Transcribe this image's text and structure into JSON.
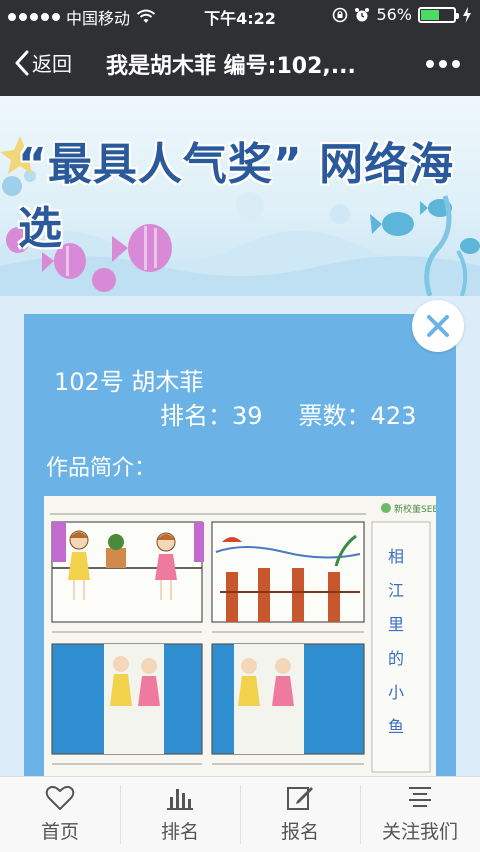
{
  "status": {
    "carrier": "中国移动",
    "time": "下午4:22",
    "battery": "56%",
    "battery_level": 0.56
  },
  "nav": {
    "back_label": "返回",
    "title": "我是胡木菲 编号:102,..."
  },
  "banner": {
    "title": "“最具人气奖” 网络海选"
  },
  "entry": {
    "name_line": "102号 胡木菲",
    "rank_text": "排名：39",
    "votes_text": "票数：423",
    "intro_label": "作品简介："
  },
  "artwork": {
    "side_title": "相江里的小鱼",
    "logo_text": "新校董SEE"
  },
  "tabs": [
    {
      "label": "首页",
      "icon": "heart-icon"
    },
    {
      "label": "排名",
      "icon": "bar-chart-icon"
    },
    {
      "label": "报名",
      "icon": "edit-icon"
    },
    {
      "label": "关注我们",
      "icon": "menu-icon"
    }
  ]
}
